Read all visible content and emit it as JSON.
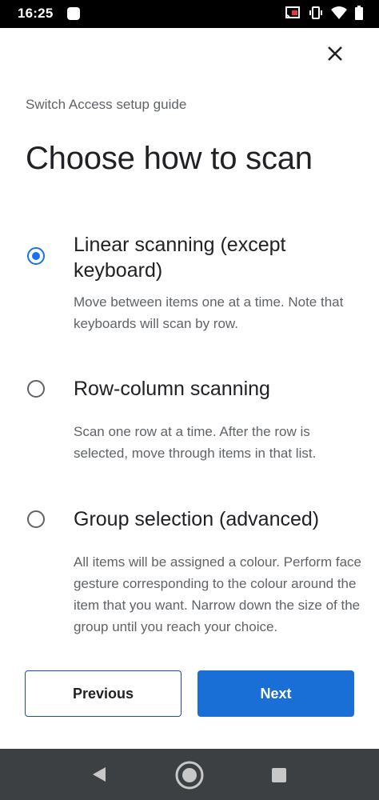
{
  "status_bar": {
    "time": "16:25"
  },
  "header": {
    "subtitle": "Switch Access setup guide",
    "title": "Choose how to scan"
  },
  "options": [
    {
      "title": "Linear scanning (except keyboard)",
      "description": "Move between items one at a time. Note that keyboards will scan by row.",
      "selected": true
    },
    {
      "title": "Row-column scanning",
      "description": "Scan one row at a time. After the row is selected, move through items in that list.",
      "selected": false
    },
    {
      "title": "Group selection (advanced)",
      "description": "All items will be assigned a colour. Perform face gesture corresponding to the colour around the item that you want. Narrow down the size of the group until you reach your choice.",
      "selected": false
    }
  ],
  "buttons": {
    "previous": "Previous",
    "next": "Next"
  },
  "colors": {
    "accent": "#1a73e8",
    "next_button": "#1a6fd6",
    "nav_bar": "#3c4043"
  }
}
